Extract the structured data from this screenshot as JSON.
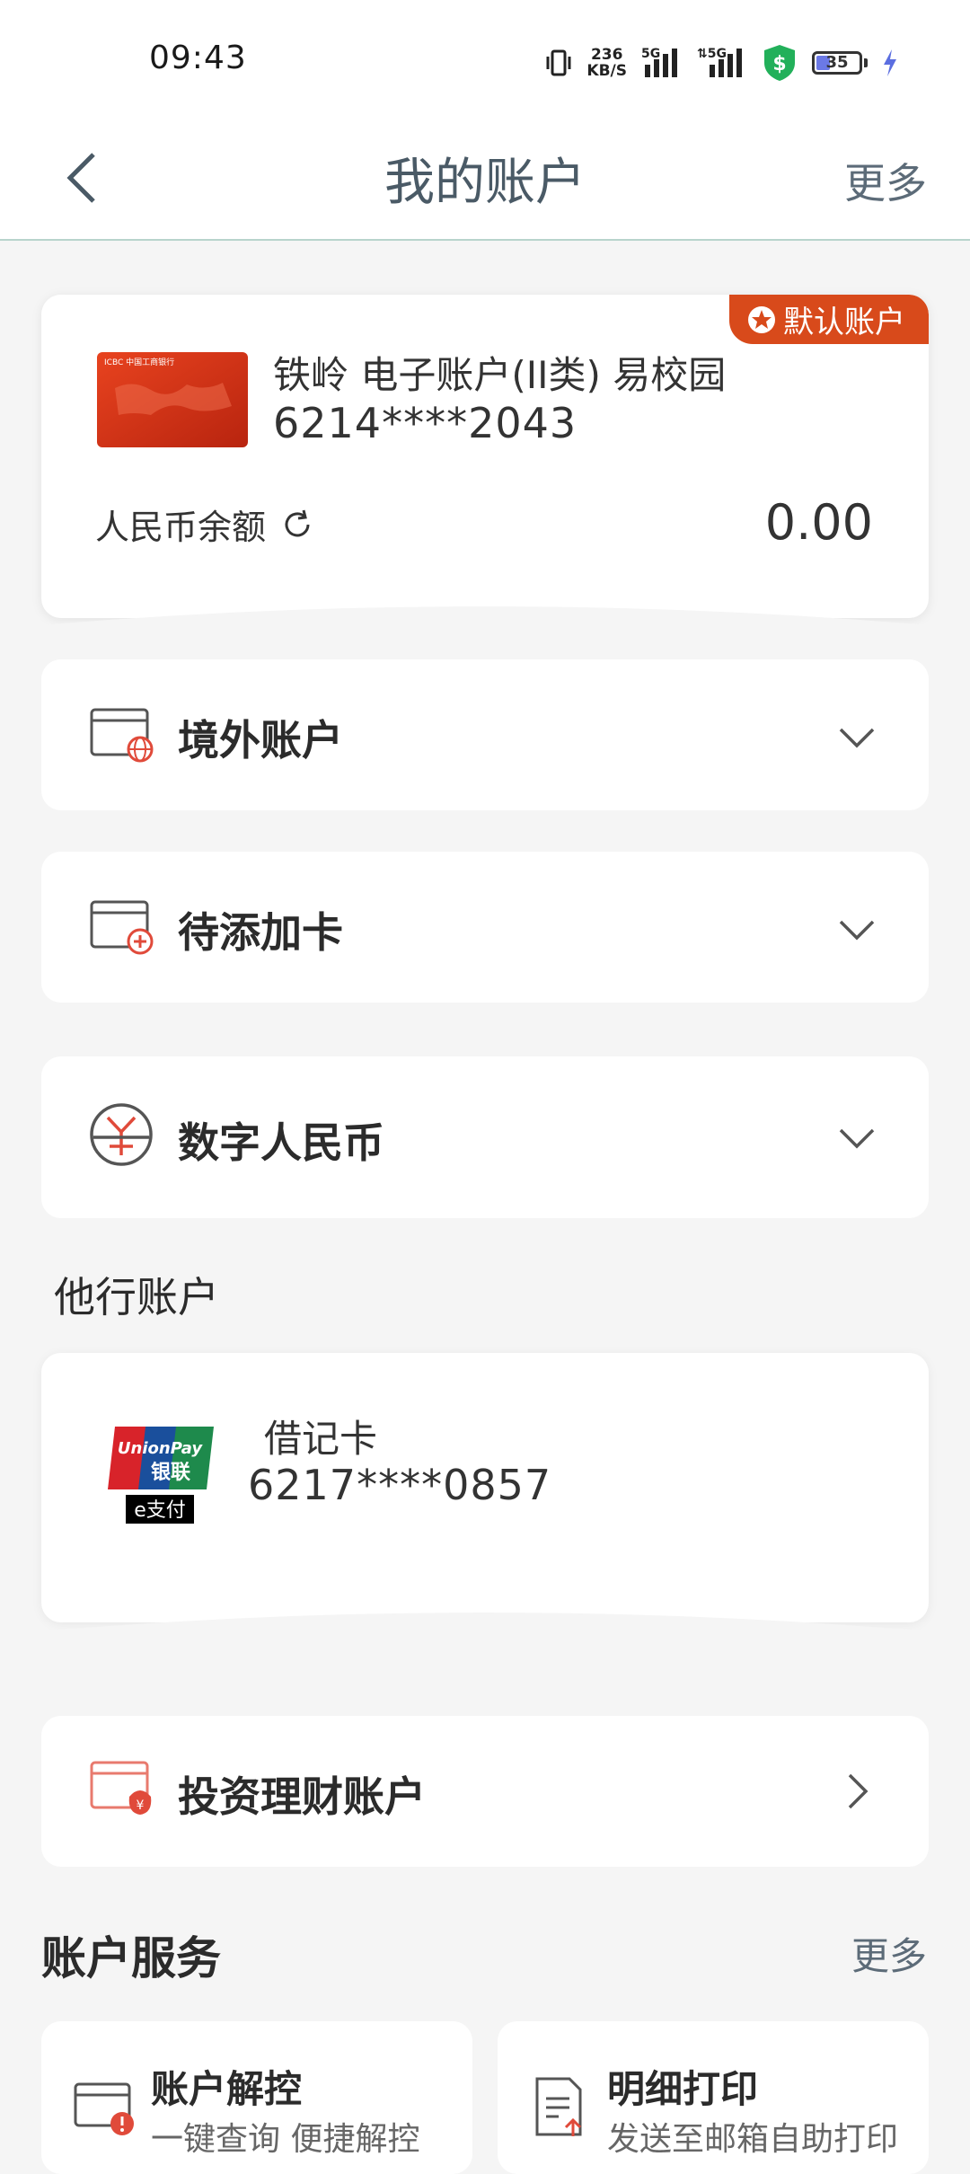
{
  "status_bar": {
    "time": "09:43",
    "net_speed_value": "236",
    "net_speed_unit": "KB/S",
    "battery_level": "35",
    "icons": [
      "vibrate-icon",
      "signal-5g-icon",
      "signal-5g-icon",
      "security-shield-icon",
      "battery-icon",
      "charging-icon"
    ]
  },
  "header": {
    "title": "我的账户",
    "more_label": "更多"
  },
  "main_account": {
    "badge": "默认账户",
    "card_brand_text": "ICBC 中国工商银行",
    "name": "铁岭 电子账户(II类) 易校园",
    "number": "6214****2043",
    "balance_label": "人民币余额",
    "balance_value": "0.00"
  },
  "sections": [
    {
      "label": "境外账户",
      "icon": "card-globe-icon"
    },
    {
      "label": "待添加卡",
      "icon": "card-add-icon"
    },
    {
      "label": "数字人民币",
      "icon": "digital-rmb-icon"
    }
  ],
  "other_bank": {
    "title": "他行账户",
    "card_type": "借记卡",
    "number": "6217****0857",
    "logo_text_top": "UnionPay",
    "logo_text_mid": "银联",
    "logo_text_bottom": "e支付"
  },
  "investment": {
    "label": "投资理财账户"
  },
  "account_services": {
    "title": "账户服务",
    "more_label": "更多",
    "items": [
      {
        "title": "账户解控",
        "subtitle": "一键查询 便捷解控"
      },
      {
        "title": "明细打印",
        "subtitle": "发送至邮箱自助打印"
      }
    ]
  },
  "colors": {
    "accent_red": "#d84a1b",
    "page_background": "#f5f5f5",
    "header_text": "#4a5a66"
  }
}
